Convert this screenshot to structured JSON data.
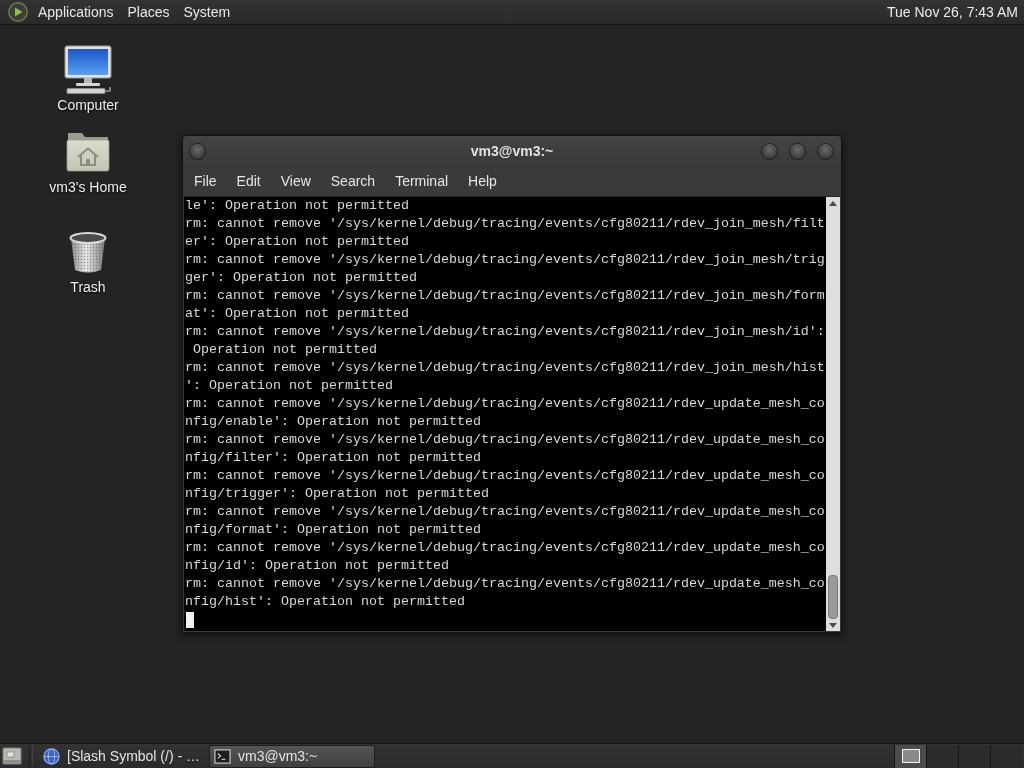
{
  "top_panel": {
    "menus": [
      "Applications",
      "Places",
      "System"
    ],
    "clock": "Tue Nov 26, 7:43 AM"
  },
  "desktop_icons": [
    {
      "kind": "computer",
      "label": "Computer"
    },
    {
      "kind": "home",
      "label": "vm3's Home"
    },
    {
      "kind": "trash",
      "label": "Trash"
    }
  ],
  "terminal_window": {
    "title": "vm3@vm3:~",
    "menu": [
      "File",
      "Edit",
      "View",
      "Search",
      "Terminal",
      "Help"
    ],
    "lines": [
      "le': Operation not permitted",
      "rm: cannot remove '/sys/kernel/debug/tracing/events/cfg80211/rdev_join_mesh/filt",
      "er': Operation not permitted",
      "rm: cannot remove '/sys/kernel/debug/tracing/events/cfg80211/rdev_join_mesh/trig",
      "ger': Operation not permitted",
      "rm: cannot remove '/sys/kernel/debug/tracing/events/cfg80211/rdev_join_mesh/form",
      "at': Operation not permitted",
      "rm: cannot remove '/sys/kernel/debug/tracing/events/cfg80211/rdev_join_mesh/id':",
      " Operation not permitted",
      "rm: cannot remove '/sys/kernel/debug/tracing/events/cfg80211/rdev_join_mesh/hist",
      "': Operation not permitted",
      "rm: cannot remove '/sys/kernel/debug/tracing/events/cfg80211/rdev_update_mesh_co",
      "nfig/enable': Operation not permitted",
      "rm: cannot remove '/sys/kernel/debug/tracing/events/cfg80211/rdev_update_mesh_co",
      "nfig/filter': Operation not permitted",
      "rm: cannot remove '/sys/kernel/debug/tracing/events/cfg80211/rdev_update_mesh_co",
      "nfig/trigger': Operation not permitted",
      "rm: cannot remove '/sys/kernel/debug/tracing/events/cfg80211/rdev_update_mesh_co",
      "nfig/format': Operation not permitted",
      "rm: cannot remove '/sys/kernel/debug/tracing/events/cfg80211/rdev_update_mesh_co",
      "nfig/id': Operation not permitted",
      "rm: cannot remove '/sys/kernel/debug/tracing/events/cfg80211/rdev_update_mesh_co",
      "nfig/hist': Operation not permitted"
    ]
  },
  "taskbar": {
    "tasks": [
      {
        "kind": "browser",
        "label": "[Slash Symbol (/) - …",
        "selected": false
      },
      {
        "kind": "terminal",
        "label": "vm3@vm3:~",
        "selected": true
      }
    ],
    "workspaces": [
      {
        "selected": true,
        "window_preview": true
      },
      {
        "selected": false,
        "window_preview": false
      },
      {
        "selected": false,
        "window_preview": false
      },
      {
        "selected": false,
        "window_preview": false
      }
    ]
  }
}
